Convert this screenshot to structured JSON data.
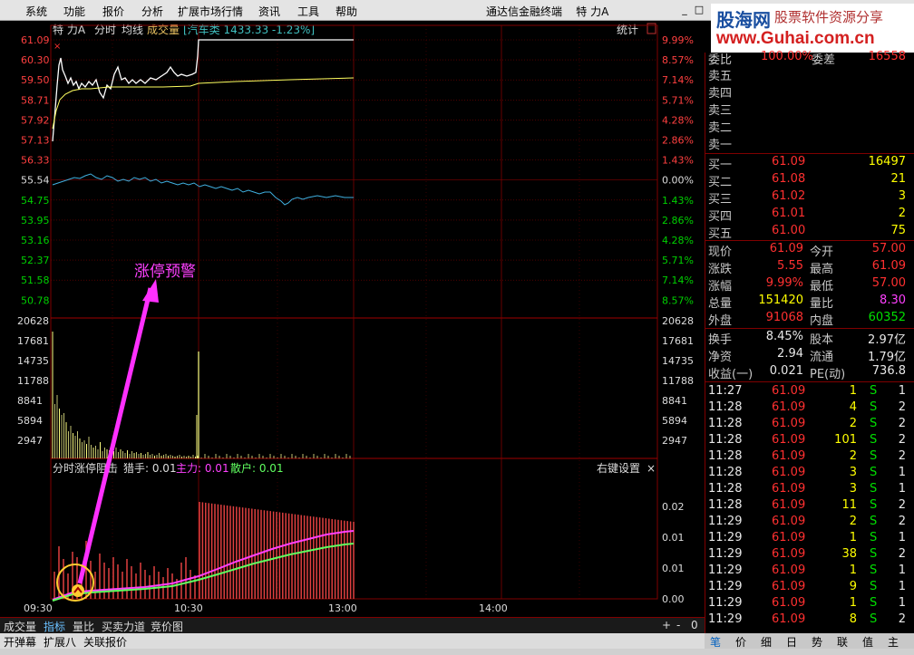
{
  "menu": {
    "items": [
      "系统",
      "功能",
      "报价",
      "分析",
      "扩展市场行情",
      "资讯",
      "工具",
      "帮助"
    ],
    "title": "通达信金融终端",
    "stock_title": "特 力A"
  },
  "logo": {
    "main": "股海网",
    "sub": "股票软件资源分享",
    "url": "www.Guhai.com.cn"
  },
  "price_chart": {
    "header": {
      "name": "特 力A",
      "tab1": "分时",
      "tab2": "均线",
      "tab3": "成交量",
      "sector": "[汽车类 1433.33 -1.23%]",
      "stat": "统计"
    },
    "prices": [
      "61.09",
      "60.30",
      "59.50",
      "58.71",
      "57.92",
      "57.13",
      "56.33",
      "55.54",
      "54.75",
      "53.95",
      "53.16",
      "52.37",
      "51.58",
      "50.78"
    ],
    "pcts": [
      "9.99%",
      "8.57%",
      "7.14%",
      "5.71%",
      "4.28%",
      "2.86%",
      "1.43%",
      "0.00%",
      "1.43%",
      "2.86%",
      "4.28%",
      "5.71%",
      "7.14%",
      "8.57%"
    ],
    "vols": [
      "20628",
      "17681",
      "14735",
      "11788",
      "8841",
      "5894",
      "2947"
    ],
    "annotation": "涨停预警"
  },
  "indicator": {
    "name": "分时涨停阻击",
    "hunter": "猎手: 0.01",
    "main": "主力: 0.01",
    "retail": "散户: 0.01",
    "settings": "右键设置",
    "close": "×",
    "ticks": [
      "0.02",
      "0.01",
      "0.01",
      "0.00"
    ]
  },
  "time_axis": [
    "09:30",
    "10:30",
    "13:00",
    "14:00"
  ],
  "bottom_tabs": [
    "成交量",
    "指标",
    "量比",
    "买卖力道",
    "竞价图"
  ],
  "bottom_ctrl": [
    "+",
    "-",
    "0"
  ],
  "bottom_bar": [
    "开弹幕",
    "扩展八",
    "关联报价"
  ],
  "right_tabs": [
    "笔",
    "价",
    "细",
    "日",
    "势",
    "联",
    "值",
    "主"
  ],
  "quote": {
    "top": {
      "l1": "委比",
      "v1": "100.00%",
      "l2": "委差",
      "v2": "16558"
    },
    "sells": [
      "卖五",
      "卖四",
      "卖三",
      "卖二",
      "卖一"
    ],
    "buys": [
      {
        "label": "买一",
        "price": "61.09",
        "vol": "16497"
      },
      {
        "label": "买二",
        "price": "61.08",
        "vol": "21"
      },
      {
        "label": "买三",
        "price": "61.02",
        "vol": "3"
      },
      {
        "label": "买四",
        "price": "61.01",
        "vol": "2"
      },
      {
        "label": "买五",
        "price": "61.00",
        "vol": "75"
      }
    ],
    "stats": [
      {
        "l1": "现价",
        "v1": "61.09",
        "c1": "red",
        "l2": "今开",
        "v2": "57.00",
        "c2": "red"
      },
      {
        "l1": "涨跌",
        "v1": "5.55",
        "c1": "red",
        "l2": "最高",
        "v2": "61.09",
        "c2": "red"
      },
      {
        "l1": "涨幅",
        "v1": "9.99%",
        "c1": "red",
        "l2": "最低",
        "v2": "57.00",
        "c2": "red"
      },
      {
        "l1": "总量",
        "v1": "151420",
        "c1": "yellow",
        "l2": "量比",
        "v2": "8.30",
        "c2": "mag"
      },
      {
        "l1": "外盘",
        "v1": "91068",
        "c1": "red",
        "l2": "内盘",
        "v2": "60352",
        "c2": "green"
      }
    ],
    "fundamentals": [
      {
        "l1": "换手",
        "v1": "8.45%",
        "l2": "股本",
        "v2": "2.97亿"
      },
      {
        "l1": "净资",
        "v1": "2.94",
        "l2": "流通",
        "v2": "1.79亿"
      },
      {
        "l1": "收益(一)",
        "v1": "0.021",
        "l2": "PE(动)",
        "v2": "736.8"
      }
    ],
    "ticks": [
      {
        "t": "11:27",
        "p": "61.09",
        "v": "1",
        "s": "S",
        "n": "1"
      },
      {
        "t": "11:28",
        "p": "61.09",
        "v": "4",
        "s": "S",
        "n": "2"
      },
      {
        "t": "11:28",
        "p": "61.09",
        "v": "2",
        "s": "S",
        "n": "2"
      },
      {
        "t": "11:28",
        "p": "61.09",
        "v": "101",
        "s": "S",
        "n": "2"
      },
      {
        "t": "11:28",
        "p": "61.09",
        "v": "2",
        "s": "S",
        "n": "2"
      },
      {
        "t": "11:28",
        "p": "61.09",
        "v": "3",
        "s": "S",
        "n": "1"
      },
      {
        "t": "11:28",
        "p": "61.09",
        "v": "3",
        "s": "S",
        "n": "1"
      },
      {
        "t": "11:28",
        "p": "61.09",
        "v": "11",
        "s": "S",
        "n": "2"
      },
      {
        "t": "11:29",
        "p": "61.09",
        "v": "2",
        "s": "S",
        "n": "2"
      },
      {
        "t": "11:29",
        "p": "61.09",
        "v": "1",
        "s": "S",
        "n": "1"
      },
      {
        "t": "11:29",
        "p": "61.09",
        "v": "38",
        "s": "S",
        "n": "2"
      },
      {
        "t": "11:29",
        "p": "61.09",
        "v": "1",
        "s": "S",
        "n": "1"
      },
      {
        "t": "11:29",
        "p": "61.09",
        "v": "9",
        "s": "S",
        "n": "1"
      },
      {
        "t": "11:29",
        "p": "61.09",
        "v": "1",
        "s": "S",
        "n": "1"
      },
      {
        "t": "11:29",
        "p": "61.09",
        "v": "8",
        "s": "S",
        "n": "2"
      }
    ]
  }
}
